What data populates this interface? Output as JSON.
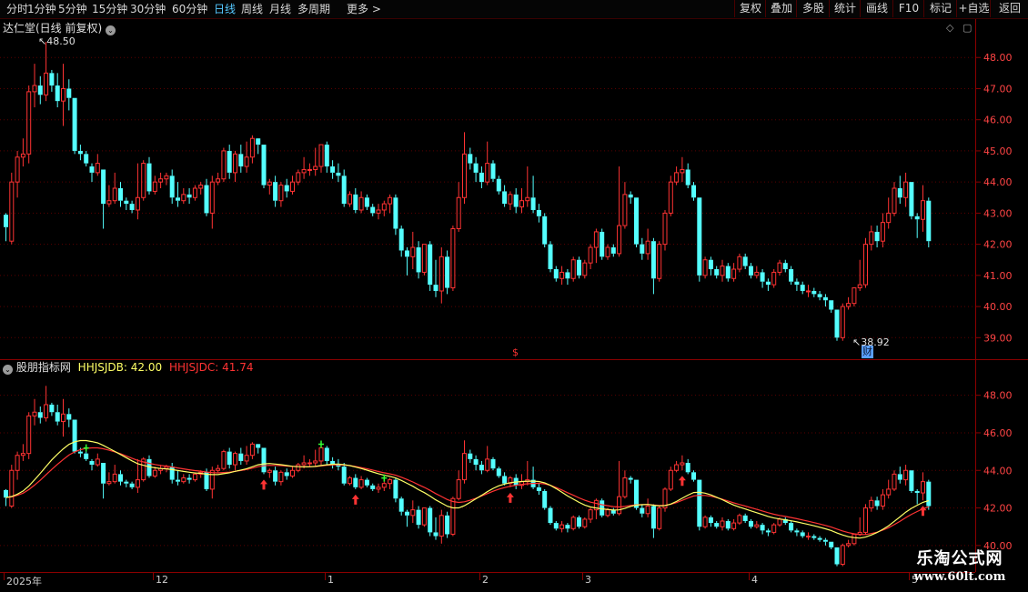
{
  "toolbar": {
    "periods": [
      "分时",
      "1分钟",
      "5分钟",
      "15分钟",
      "30分钟",
      "60分钟",
      "日线",
      "周线",
      "月线",
      "多周期",
      "更多 >"
    ],
    "active_period": "日线",
    "right_buttons": [
      "复权",
      "叠加",
      "多股",
      "统计",
      "画线",
      "F10",
      "标记",
      "+自选",
      "返回"
    ]
  },
  "main_chart": {
    "title": "达仁堂(日线 前复权)",
    "high_label": "48.50",
    "low_label": "38.92",
    "marker_dollar": "$",
    "marker_cai": "财",
    "y_ticks": [
      "48.00",
      "47.00",
      "46.00",
      "45.00",
      "44.00",
      "43.00",
      "42.00",
      "41.00",
      "40.00",
      "39.00"
    ]
  },
  "indicator": {
    "name": "股朋指标网",
    "line1_label": "HHJSJDB: 42.00",
    "line2_label": "HHJSJDC: 41.74",
    "y_ticks": [
      "48.00",
      "46.00",
      "44.00",
      "42.00",
      "40.00"
    ]
  },
  "date_axis": [
    {
      "label": "2025年",
      "index": 0
    },
    {
      "label": "12",
      "index": 26
    },
    {
      "label": "1",
      "index": 56
    },
    {
      "label": "2",
      "index": 83
    },
    {
      "label": "3",
      "index": 101
    },
    {
      "label": "4",
      "index": 130
    },
    {
      "label": "5",
      "index": 158
    }
  ],
  "watermark": {
    "name": "乐淘公式网",
    "url": "www.60lt.com"
  },
  "colors": {
    "up": "#ff3333",
    "down": "#54ffff",
    "ma_fast": "#ffff66",
    "ma_slow": "#ff3333",
    "border": "#8b0000",
    "arrow": "#ff3333",
    "cross": "#33ff33"
  },
  "chart_data": {
    "type": "candlestick",
    "price_range": [
      38.6,
      49.0
    ],
    "indicator_range": [
      39.8,
      49.0
    ],
    "candles": [
      [
        42.95,
        42.55,
        42.1,
        43.0
      ],
      [
        42.1,
        44.0,
        42.0,
        44.3
      ],
      [
        44.0,
        44.8,
        43.5,
        45.0
      ],
      [
        44.8,
        44.9,
        44.5,
        45.4
      ],
      [
        44.9,
        46.9,
        44.6,
        47.1
      ],
      [
        46.9,
        47.1,
        46.4,
        47.8
      ],
      [
        47.1,
        46.8,
        46.5,
        47.4
      ],
      [
        46.8,
        47.5,
        46.6,
        48.5
      ],
      [
        47.5,
        47.1,
        46.9,
        47.6
      ],
      [
        47.1,
        46.6,
        46.4,
        47.5
      ],
      [
        46.6,
        47.0,
        45.8,
        47.8
      ],
      [
        47.0,
        46.7,
        46.3,
        47.3
      ],
      [
        46.7,
        45.0,
        44.9,
        46.7
      ],
      [
        45.0,
        44.9,
        44.7,
        45.2
      ],
      [
        44.9,
        44.6,
        44.5,
        45.0
      ],
      [
        44.5,
        44.3,
        44.0,
        44.6
      ],
      [
        44.3,
        44.6,
        44.2,
        44.9
      ],
      [
        44.4,
        43.3,
        42.5,
        44.4
      ],
      [
        43.3,
        43.4,
        43.2,
        43.9
      ],
      [
        43.4,
        43.8,
        43.3,
        44.3
      ],
      [
        43.8,
        43.4,
        43.2,
        44.0
      ],
      [
        43.4,
        43.3,
        43.1,
        43.5
      ],
      [
        43.3,
        43.1,
        43.0,
        43.4
      ],
      [
        43.1,
        43.5,
        42.8,
        44.6
      ],
      [
        43.5,
        44.6,
        43.4,
        44.7
      ],
      [
        44.6,
        43.7,
        43.6,
        44.8
      ],
      [
        43.7,
        44.0,
        43.6,
        44.2
      ],
      [
        44.0,
        44.1,
        43.8,
        44.3
      ],
      [
        44.1,
        44.2,
        43.9,
        44.3
      ],
      [
        44.2,
        43.5,
        43.3,
        44.4
      ],
      [
        43.5,
        43.4,
        43.2,
        44.0
      ],
      [
        43.4,
        43.6,
        43.3,
        43.8
      ],
      [
        43.6,
        43.5,
        43.3,
        43.8
      ],
      [
        43.5,
        43.8,
        43.4,
        43.9
      ],
      [
        43.8,
        43.9,
        43.6,
        44.0
      ],
      [
        43.9,
        43.0,
        42.9,
        44.1
      ],
      [
        43.0,
        44.0,
        42.5,
        44.2
      ],
      [
        44.0,
        44.1,
        43.9,
        44.3
      ],
      [
        44.1,
        45.0,
        44.0,
        45.1
      ],
      [
        45.0,
        44.3,
        44.1,
        45.2
      ],
      [
        44.3,
        44.9,
        44.0,
        45.0
      ],
      [
        44.9,
        44.5,
        44.3,
        45.2
      ],
      [
        44.5,
        44.8,
        44.3,
        45.3
      ],
      [
        44.8,
        45.4,
        44.6,
        45.5
      ],
      [
        45.4,
        45.2,
        44.9,
        45.3
      ],
      [
        45.2,
        43.9,
        43.8,
        45.2
      ],
      [
        43.9,
        44.0,
        43.6,
        44.1
      ],
      [
        44.0,
        43.4,
        43.2,
        44.2
      ],
      [
        43.4,
        43.9,
        43.2,
        44.0
      ],
      [
        43.9,
        43.7,
        43.5,
        44.1
      ],
      [
        43.7,
        44.0,
        43.6,
        44.2
      ],
      [
        44.0,
        44.3,
        43.9,
        44.4
      ],
      [
        44.3,
        44.4,
        44.1,
        44.8
      ],
      [
        44.4,
        44.4,
        44.2,
        44.6
      ],
      [
        44.4,
        44.5,
        44.2,
        45.1
      ],
      [
        44.5,
        45.2,
        44.3,
        45.2
      ],
      [
        45.2,
        44.5,
        44.3,
        45.3
      ],
      [
        44.5,
        44.3,
        44.1,
        44.7
      ],
      [
        44.3,
        44.2,
        44.0,
        44.6
      ],
      [
        44.2,
        43.3,
        43.2,
        44.4
      ],
      [
        43.3,
        43.6,
        43.2,
        43.7
      ],
      [
        43.6,
        43.1,
        43.0,
        43.8
      ],
      [
        43.1,
        43.5,
        43.0,
        43.7
      ],
      [
        43.5,
        43.2,
        43.1,
        43.6
      ],
      [
        43.2,
        43.0,
        42.9,
        43.3
      ],
      [
        43.0,
        43.1,
        42.8,
        43.3
      ],
      [
        43.1,
        43.3,
        42.9,
        43.4
      ],
      [
        43.3,
        43.5,
        43.0,
        43.6
      ],
      [
        43.5,
        42.5,
        42.3,
        43.6
      ],
      [
        42.5,
        41.8,
        41.6,
        42.6
      ],
      [
        41.8,
        41.6,
        41.0,
        41.9
      ],
      [
        41.6,
        41.9,
        41.2,
        42.4
      ],
      [
        41.9,
        41.1,
        40.9,
        42.1
      ],
      [
        41.1,
        42.0,
        41.0,
        42.0
      ],
      [
        42.0,
        40.7,
        40.5,
        42.1
      ],
      [
        40.7,
        40.5,
        40.3,
        41.5
      ],
      [
        40.5,
        41.6,
        40.1,
        41.9
      ],
      [
        41.6,
        40.6,
        40.4,
        41.8
      ],
      [
        40.6,
        42.5,
        40.5,
        42.6
      ],
      [
        42.5,
        43.5,
        42.4,
        44.0
      ],
      [
        43.5,
        44.9,
        43.3,
        45.6
      ],
      [
        44.9,
        44.6,
        44.4,
        45.1
      ],
      [
        44.6,
        44.3,
        44.0,
        44.8
      ],
      [
        44.3,
        44.0,
        43.8,
        44.5
      ],
      [
        44.0,
        44.6,
        43.9,
        45.3
      ],
      [
        44.6,
        44.1,
        44.0,
        44.7
      ],
      [
        44.1,
        43.7,
        43.6,
        44.2
      ],
      [
        43.7,
        43.3,
        43.2,
        43.9
      ],
      [
        43.3,
        43.6,
        43.1,
        43.7
      ],
      [
        43.6,
        43.2,
        43.0,
        43.8
      ],
      [
        43.2,
        43.4,
        43.0,
        43.8
      ],
      [
        43.4,
        43.5,
        43.2,
        44.5
      ],
      [
        43.5,
        43.1,
        43.0,
        44.2
      ],
      [
        43.1,
        42.9,
        42.7,
        43.3
      ],
      [
        42.9,
        42.0,
        41.9,
        43.0
      ],
      [
        42.0,
        41.2,
        41.1,
        42.1
      ],
      [
        41.2,
        40.9,
        40.8,
        41.3
      ],
      [
        40.9,
        41.1,
        40.7,
        41.3
      ],
      [
        41.1,
        40.9,
        40.7,
        41.2
      ],
      [
        40.9,
        41.5,
        40.8,
        41.6
      ],
      [
        41.5,
        41.0,
        40.9,
        41.6
      ],
      [
        41.0,
        41.4,
        40.9,
        41.5
      ],
      [
        41.4,
        41.9,
        41.2,
        42.0
      ],
      [
        41.9,
        42.4,
        41.4,
        42.5
      ],
      [
        42.4,
        41.6,
        41.5,
        42.5
      ],
      [
        41.6,
        41.9,
        41.5,
        42.0
      ],
      [
        41.9,
        41.7,
        41.6,
        42.0
      ],
      [
        41.7,
        42.6,
        41.6,
        44.5
      ],
      [
        42.6,
        43.6,
        42.5,
        44.0
      ],
      [
        43.6,
        43.5,
        43.3,
        43.7
      ],
      [
        43.5,
        42.0,
        41.9,
        43.5
      ],
      [
        42.0,
        41.7,
        41.5,
        42.2
      ],
      [
        41.7,
        42.1,
        41.5,
        42.5
      ],
      [
        42.1,
        40.9,
        40.4,
        42.2
      ],
      [
        40.9,
        42.0,
        40.8,
        42.1
      ],
      [
        42.0,
        43.0,
        41.8,
        43.1
      ],
      [
        43.0,
        44.0,
        42.9,
        44.2
      ],
      [
        44.0,
        44.3,
        43.9,
        44.5
      ],
      [
        44.3,
        44.4,
        44.0,
        44.8
      ],
      [
        44.4,
        43.9,
        43.8,
        44.6
      ],
      [
        43.9,
        43.5,
        43.4,
        44.0
      ],
      [
        43.5,
        41.0,
        40.8,
        43.5
      ],
      [
        41.0,
        41.5,
        40.9,
        41.6
      ],
      [
        41.5,
        41.2,
        41.0,
        41.6
      ],
      [
        41.2,
        41.0,
        40.9,
        41.3
      ],
      [
        41.0,
        41.3,
        40.8,
        41.5
      ],
      [
        41.3,
        40.9,
        40.8,
        41.4
      ],
      [
        40.9,
        41.2,
        40.8,
        41.4
      ],
      [
        41.2,
        41.6,
        41.1,
        41.7
      ],
      [
        41.6,
        41.3,
        41.2,
        41.7
      ],
      [
        41.3,
        41.0,
        40.9,
        41.4
      ],
      [
        41.0,
        41.1,
        40.9,
        41.3
      ],
      [
        41.1,
        40.8,
        40.6,
        41.2
      ],
      [
        40.8,
        40.7,
        40.5,
        40.9
      ],
      [
        40.7,
        41.1,
        40.6,
        41.2
      ],
      [
        41.1,
        41.4,
        41.0,
        41.5
      ],
      [
        41.4,
        41.2,
        41.1,
        41.5
      ],
      [
        41.2,
        40.8,
        40.7,
        41.3
      ],
      [
        40.8,
        40.7,
        40.5,
        40.9
      ],
      [
        40.7,
        40.5,
        40.4,
        40.8
      ],
      [
        40.5,
        40.5,
        40.3,
        40.7
      ],
      [
        40.5,
        40.4,
        40.3,
        40.6
      ],
      [
        40.4,
        40.3,
        40.2,
        40.5
      ],
      [
        40.3,
        40.2,
        40.0,
        40.4
      ],
      [
        40.2,
        39.9,
        39.8,
        40.2
      ],
      [
        39.9,
        39.0,
        38.9,
        39.9
      ],
      [
        39.0,
        40.0,
        38.9,
        40.1
      ],
      [
        40.0,
        40.1,
        39.9,
        40.3
      ],
      [
        40.1,
        40.6,
        40.0,
        40.6
      ],
      [
        40.6,
        40.7,
        40.5,
        41.5
      ],
      [
        40.7,
        42.0,
        40.6,
        42.2
      ],
      [
        42.0,
        42.4,
        41.8,
        42.6
      ],
      [
        42.4,
        42.1,
        41.9,
        42.6
      ],
      [
        42.1,
        42.7,
        41.9,
        43.0
      ],
      [
        42.7,
        43.0,
        42.5,
        43.5
      ],
      [
        43.0,
        43.8,
        42.9,
        44.0
      ],
      [
        43.8,
        43.5,
        43.3,
        44.2
      ],
      [
        43.5,
        44.0,
        43.2,
        44.3
      ],
      [
        44.0,
        42.9,
        42.8,
        44.0
      ],
      [
        42.9,
        42.8,
        42.2,
        43.0
      ],
      [
        42.8,
        43.4,
        42.4,
        43.9
      ],
      [
        43.4,
        42.1,
        41.9,
        43.5
      ]
    ],
    "buy_arrow_indices": [
      45,
      61,
      88,
      118,
      160
    ],
    "cross_marker_indices": [
      14,
      55,
      66
    ]
  }
}
